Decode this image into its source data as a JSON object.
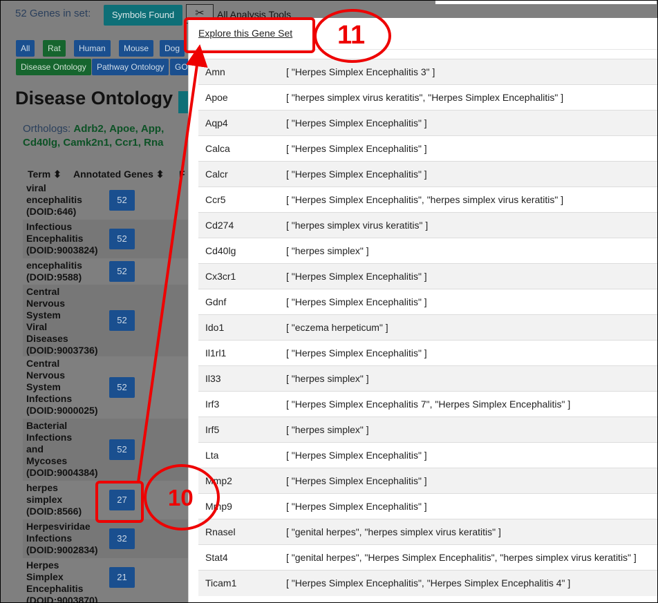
{
  "header": {
    "gene_count": "52 Genes in set:",
    "symbols_found": "Symbols Found",
    "analysis_tools": "All Analysis Tools"
  },
  "filters": {
    "species": [
      "All",
      "Rat",
      "Human",
      "Mouse",
      "Dog"
    ],
    "ontologies": [
      "Disease Ontology",
      "Pathway Ontology",
      "GO"
    ]
  },
  "section": {
    "title": "Disease Ontology",
    "orthologs_label": "Orthologs:",
    "orthologs_line1": [
      "Adrb2,",
      "Apoe,",
      "App,"
    ],
    "orthologs_line2": [
      "Cd40lg,",
      "Camk2n1,",
      "Ccr1,",
      "Rna"
    ]
  },
  "table": {
    "col_term": "Term",
    "col_genes": "Annotated Genes",
    "col_extra": "F",
    "rows": [
      {
        "term": [
          "viral",
          "encephalitis",
          "(DOID:646)"
        ],
        "count": "52"
      },
      {
        "term": [
          "Infectious",
          "Encephalitis",
          "(DOID:9003824)"
        ],
        "count": "52"
      },
      {
        "term": [
          "encephalitis",
          "(DOID:9588)"
        ],
        "count": "52"
      },
      {
        "term": [
          "Central",
          "Nervous",
          "System",
          "Viral",
          "Diseases",
          "(DOID:9003736)"
        ],
        "count": "52"
      },
      {
        "term": [
          "Central",
          "Nervous",
          "System",
          "Infections",
          "(DOID:9000025)"
        ],
        "count": "52"
      },
      {
        "term": [
          "Bacterial",
          "Infections",
          "and",
          "Mycoses",
          "(DOID:9004384)"
        ],
        "count": "52"
      },
      {
        "term": [
          "herpes",
          "simplex",
          "(DOID:8566)"
        ],
        "count": "27"
      },
      {
        "term": [
          "Herpesviridae",
          "Infections",
          "(DOID:9002834)"
        ],
        "count": "32"
      },
      {
        "term": [
          "Herpes",
          "Simplex",
          "Encephalitis",
          "(DOID:9003870)"
        ],
        "count": "21"
      }
    ]
  },
  "panel": {
    "explore_link": "Explore this Gene Set",
    "genes": [
      {
        "gene": "Amn",
        "diseases": "[ \"Herpes Simplex Encephalitis 3\" ]"
      },
      {
        "gene": "Apoe",
        "diseases": "[ \"herpes simplex virus keratitis\", \"Herpes Simplex Encephalitis\" ]"
      },
      {
        "gene": "Aqp4",
        "diseases": "[ \"Herpes Simplex Encephalitis\" ]"
      },
      {
        "gene": "Calca",
        "diseases": "[ \"Herpes Simplex Encephalitis\" ]"
      },
      {
        "gene": "Calcr",
        "diseases": "[ \"Herpes Simplex Encephalitis\" ]"
      },
      {
        "gene": "Ccr5",
        "diseases": "[ \"Herpes Simplex Encephalitis\", \"herpes simplex virus keratitis\" ]"
      },
      {
        "gene": "Cd274",
        "diseases": "[ \"herpes simplex virus keratitis\" ]"
      },
      {
        "gene": "Cd40lg",
        "diseases": "[ \"herpes simplex\" ]"
      },
      {
        "gene": "Cx3cr1",
        "diseases": "[ \"Herpes Simplex Encephalitis\" ]"
      },
      {
        "gene": "Gdnf",
        "diseases": "[ \"Herpes Simplex Encephalitis\" ]"
      },
      {
        "gene": "Ido1",
        "diseases": "[ \"eczema herpeticum\" ]"
      },
      {
        "gene": "Il1rl1",
        "diseases": "[ \"Herpes Simplex Encephalitis\" ]"
      },
      {
        "gene": "Il33",
        "diseases": "[ \"herpes simplex\" ]"
      },
      {
        "gene": "Irf3",
        "diseases": "[ \"Herpes Simplex Encephalitis 7\", \"Herpes Simplex Encephalitis\" ]"
      },
      {
        "gene": "Irf5",
        "diseases": "[ \"herpes simplex\" ]"
      },
      {
        "gene": "Lta",
        "diseases": "[ \"Herpes Simplex Encephalitis\" ]"
      },
      {
        "gene": "Mmp2",
        "diseases": "[ \"Herpes Simplex Encephalitis\" ]"
      },
      {
        "gene": "Mmp9",
        "diseases": "[ \"Herpes Simplex Encephalitis\" ]"
      },
      {
        "gene": "Rnasel",
        "diseases": "[ \"genital herpes\", \"herpes simplex virus keratitis\" ]"
      },
      {
        "gene": "Stat4",
        "diseases": "[ \"genital herpes\", \"Herpes Simplex Encephalitis\", \"herpes simplex virus keratitis\" ]"
      },
      {
        "gene": "Ticam1",
        "diseases": "[ \"Herpes Simplex Encephalitis\", \"Herpes Simplex Encephalitis 4\" ]"
      }
    ]
  },
  "annotations": {
    "step_10": "10",
    "step_11": "11",
    "color": "#ee0000"
  }
}
